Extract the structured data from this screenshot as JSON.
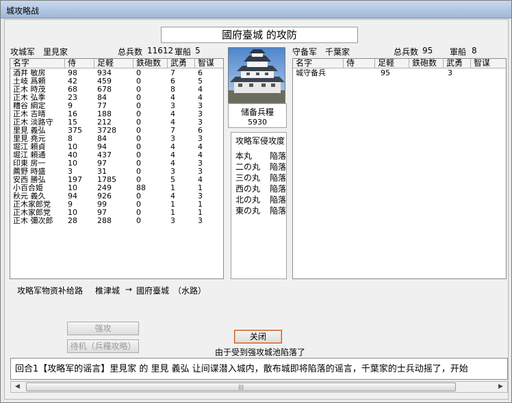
{
  "window": {
    "title": "城攻略战"
  },
  "heading": "國府臺城 的攻防",
  "attacker": {
    "label": "攻城军",
    "clan": "里見家",
    "troops_label": "总兵数",
    "troops": "11612",
    "ships_label": "軍船",
    "ships": "5"
  },
  "defender": {
    "label": "守备军",
    "clan": "千葉家",
    "troops_label": "总兵数",
    "troops": "95",
    "ships_label": "軍船",
    "ships": "8"
  },
  "columns": [
    "名字",
    "侍",
    "足軽",
    "鉄砲数",
    "武勇",
    "智谋"
  ],
  "attacker_rows": [
    [
      "酒井 敏房",
      "98",
      "934",
      "0",
      "7",
      "6"
    ],
    [
      "土岐 爲頼",
      "42",
      "459",
      "0",
      "6",
      "5"
    ],
    [
      "正木 時茂",
      "68",
      "678",
      "0",
      "8",
      "4"
    ],
    [
      "正木 弘季",
      "23",
      "84",
      "0",
      "4",
      "4"
    ],
    [
      "糟谷 綱定",
      "9",
      "77",
      "0",
      "3",
      "3"
    ],
    [
      "正木 吉晴",
      "16",
      "188",
      "0",
      "4",
      "3"
    ],
    [
      "正木 淡路守",
      "15",
      "212",
      "0",
      "4",
      "3"
    ],
    [
      "里見 義弘",
      "375",
      "3728",
      "0",
      "7",
      "6"
    ],
    [
      "里見 堯元",
      "8",
      "84",
      "0",
      "3",
      "3"
    ],
    [
      "堀江 頼貞",
      "10",
      "94",
      "0",
      "4",
      "4"
    ],
    [
      "堀江 頼通",
      "40",
      "437",
      "0",
      "4",
      "4"
    ],
    [
      "印東 房一",
      "10",
      "97",
      "0",
      "4",
      "3"
    ],
    [
      "薦野 時盛",
      "3",
      "31",
      "0",
      "3",
      "3"
    ],
    [
      "安西 勝弘",
      "197",
      "1785",
      "0",
      "5",
      "4"
    ],
    [
      "小百合姫",
      "10",
      "249",
      "88",
      "1",
      "1"
    ],
    [
      "秋元 義久",
      "94",
      "926",
      "0",
      "4",
      "3"
    ],
    [
      "正木家郎党",
      "9",
      "99",
      "0",
      "1",
      "1"
    ],
    [
      "正木家郎党",
      "10",
      "97",
      "0",
      "1",
      "1"
    ],
    [
      "正木 彌次郎",
      "28",
      "288",
      "0",
      "3",
      "3"
    ]
  ],
  "defender_rows": [
    [
      "城守备兵",
      "",
      "95",
      "",
      "3",
      ""
    ]
  ],
  "storage": {
    "label": "储备兵糧",
    "value": "5930"
  },
  "siege": {
    "title": "攻略军侵攻度",
    "items": [
      {
        "name": "本丸",
        "status": "陥落"
      },
      {
        "name": "二の丸",
        "status": "陥落"
      },
      {
        "name": "三の丸",
        "status": "陥落"
      },
      {
        "name": "西の丸",
        "status": "陥落"
      },
      {
        "name": "北の丸",
        "status": "陥落"
      },
      {
        "name": "東の丸",
        "status": "陥落"
      }
    ]
  },
  "supply": {
    "label": "攻略军物资补给路",
    "from": "椎津城",
    "arrow": "→",
    "to": "國府臺城",
    "route": "（水路）"
  },
  "buttons": {
    "assault": "强攻",
    "wait": "待机（兵糧攻略）",
    "close": "关闭"
  },
  "notice": "由于受到强攻城池陷落了",
  "log": "回合1【攻略军的谣言】里見家 的 里見 義弘 让间谍潜入城内，散布城即将陷落的谣言，千葉家的士兵动摇了，开始"
}
